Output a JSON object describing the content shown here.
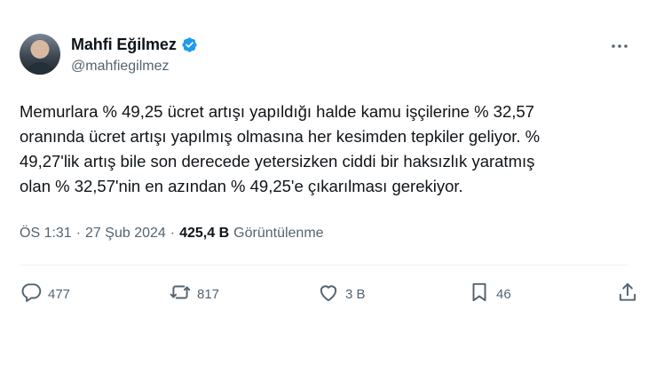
{
  "author": {
    "display_name": "Mahfi Eğilmez",
    "handle": "@mahfiegilmez",
    "verified": true
  },
  "tweet": {
    "text": "Memurlara % 49,25 ücret artışı yapıldığı halde kamu işçilerine % 32,57\noranında ücret artışı yapılmış olmasına her kesimden tepkiler geliyor. %\n49,27'lik artış bile son derecede yetersizken ciddi bir haksızlık yaratmış\nolan % 32,57'nin en azından % 49,25'e çıkarılması gerekiyor."
  },
  "meta": {
    "time": "ÖS 1:31",
    "separator": "·",
    "date": "27 Şub 2024",
    "views_count": "425,4 B",
    "views_label": "Görüntülenme"
  },
  "actions": {
    "replies": "477",
    "reposts": "817",
    "likes": "3 B",
    "bookmarks": "46"
  },
  "colors": {
    "text": "#0f1419",
    "secondary": "#536471",
    "verified": "#1d9bf0",
    "divider": "#eff3f4"
  },
  "icons": [
    "verified-badge-icon",
    "more-icon",
    "reply-icon",
    "repost-icon",
    "like-icon",
    "bookmark-icon",
    "share-icon"
  ]
}
